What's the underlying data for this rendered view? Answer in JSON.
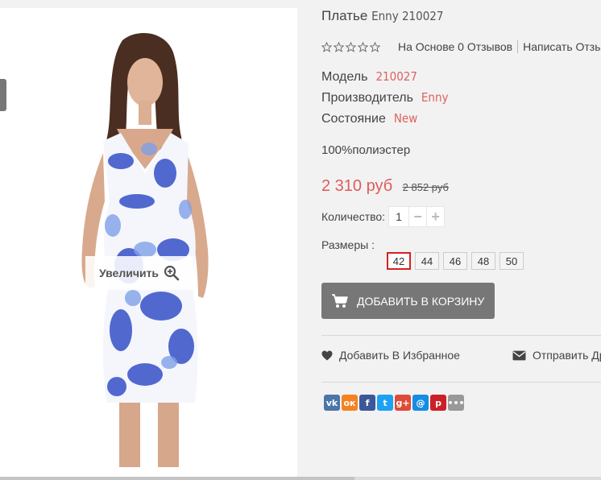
{
  "product": {
    "title_main": "Платье",
    "title_brand": "Enny 210027",
    "zoom_label": "Увеличить",
    "rating": {
      "stars": 0,
      "reviews_text": "На Основе 0 Отзывов",
      "write_review": "Написать Отзыв"
    },
    "attributes": {
      "model_label": "Модель",
      "model_value": "210027",
      "maker_label": "Производитель",
      "maker_value": "Enny",
      "condition_label": "Состояние",
      "condition_value": "New"
    },
    "material": "100%полиэстер",
    "price": {
      "current": "2 310 руб",
      "old": "2 852 руб"
    },
    "quantity": {
      "label": "Количество:",
      "value": "1",
      "minus": "−",
      "plus": "+"
    },
    "sizes": {
      "label": "Размеры :",
      "options": [
        "42",
        "44",
        "46",
        "48",
        "50"
      ],
      "selected": "42"
    },
    "cart_button": "ДОБАВИТЬ В КОРЗИНУ",
    "wishlist": "Добавить В Избранное",
    "send": "Отправить Другу"
  },
  "share_icons": [
    {
      "name": "vk-icon",
      "glyph": "vk",
      "color": "#4a76a8"
    },
    {
      "name": "odnoklassniki-icon",
      "glyph": "ок",
      "color": "#f58220"
    },
    {
      "name": "facebook-icon",
      "glyph": "f",
      "color": "#3b5998"
    },
    {
      "name": "twitter-icon",
      "glyph": "t",
      "color": "#1da1f2"
    },
    {
      "name": "google-plus-icon",
      "glyph": "g+",
      "color": "#dd4b39"
    },
    {
      "name": "mailru-icon",
      "glyph": "@",
      "color": "#168de2"
    },
    {
      "name": "pinterest-icon",
      "glyph": "p",
      "color": "#cb2027"
    },
    {
      "name": "more-share-icon",
      "glyph": "•••",
      "color": "#999999"
    }
  ],
  "colors": {
    "accent": "#e05a5a",
    "button": "#777777",
    "selected_border": "#d72020"
  }
}
